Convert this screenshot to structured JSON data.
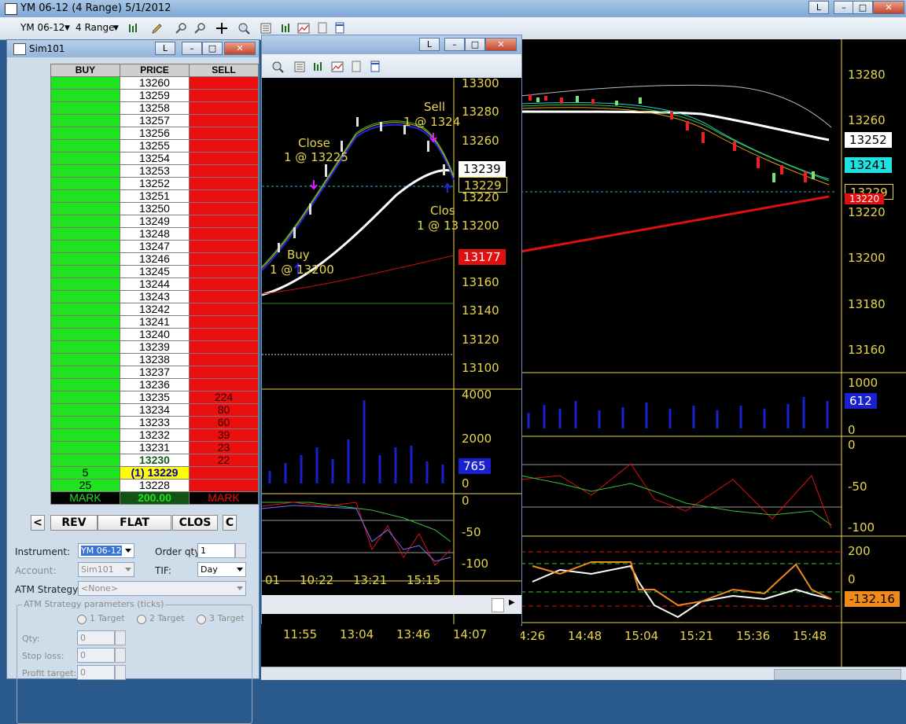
{
  "window": {
    "title": "YM 06-12 (4 Range)  5/1/2012",
    "link_btn": "L",
    "min_btn": "–",
    "max_btn": "□",
    "close_btn": "✕"
  },
  "toolbar": {
    "instrument": "YM 06-12",
    "period": "4 Range"
  },
  "main_chart": {
    "price_axis": [
      "13280",
      "13260",
      "13240",
      "13220",
      "13200",
      "13180",
      "13160"
    ],
    "tags": {
      "white": "13252",
      "cyan": "13241",
      "last": "13229",
      "red": "13220"
    },
    "volume_axis": [
      "1000",
      "500",
      "0"
    ],
    "volume_tag": "612",
    "osc_axis": [
      "0",
      "-50",
      "-100"
    ],
    "cci_axis": [
      "200",
      "0",
      "-200"
    ],
    "cci_tag": "-132.16",
    "time_axis": [
      "14:26",
      "14:48",
      "15:04",
      "15:21",
      "15:36",
      "15:48"
    ],
    "colors": {
      "axis_text": "#e8d54a",
      "ema_red": "#e01010",
      "band_white": "#ffffff",
      "last_line": "#22b8d6"
    }
  },
  "inner_chart": {
    "link_btn": "L",
    "price_axis": [
      "13300",
      "13280",
      "13260",
      "13240",
      "13220",
      "13200",
      "13180",
      "13160",
      "13140",
      "13120",
      "13100"
    ],
    "tags": {
      "white": "13239",
      "last": "13229",
      "red": "13177"
    },
    "volume_axis": [
      "4000",
      "2000",
      "0"
    ],
    "volume_tag": "765",
    "osc_axis": [
      "0",
      "-50",
      "-100"
    ],
    "time_axis": [
      "10:22",
      "13:21",
      "15:15"
    ],
    "time_partial": "01",
    "bottom_time_axis": [
      "11:55",
      "13:04",
      "13:46",
      "14:07"
    ],
    "annotations": {
      "close1_line1": "Close",
      "close1_line2": "1 @ 13225",
      "buy_line1": "Buy",
      "buy_line2": "1 @ 13200",
      "sell_line1": "Sell",
      "sell_line2": "1 @ 1324",
      "close2_line1": "Clos",
      "close2_line2": "1 @ 13"
    }
  },
  "dom": {
    "title": "Sim101",
    "link_btn": "L",
    "headers": {
      "buy": "BUY",
      "price": "PRICE",
      "sell": "SELL"
    },
    "rows": [
      {
        "buy": "",
        "price": "13260",
        "sell": ""
      },
      {
        "buy": "",
        "price": "13259",
        "sell": ""
      },
      {
        "buy": "",
        "price": "13258",
        "sell": ""
      },
      {
        "buy": "",
        "price": "13257",
        "sell": ""
      },
      {
        "buy": "",
        "price": "13256",
        "sell": ""
      },
      {
        "buy": "",
        "price": "13255",
        "sell": ""
      },
      {
        "buy": "",
        "price": "13254",
        "sell": ""
      },
      {
        "buy": "",
        "price": "13253",
        "sell": ""
      },
      {
        "buy": "",
        "price": "13252",
        "sell": ""
      },
      {
        "buy": "",
        "price": "13251",
        "sell": ""
      },
      {
        "buy": "",
        "price": "13250",
        "sell": ""
      },
      {
        "buy": "",
        "price": "13249",
        "sell": ""
      },
      {
        "buy": "",
        "price": "13248",
        "sell": ""
      },
      {
        "buy": "",
        "price": "13247",
        "sell": ""
      },
      {
        "buy": "",
        "price": "13246",
        "sell": ""
      },
      {
        "buy": "",
        "price": "13245",
        "sell": ""
      },
      {
        "buy": "",
        "price": "13244",
        "sell": ""
      },
      {
        "buy": "",
        "price": "13243",
        "sell": ""
      },
      {
        "buy": "",
        "price": "13242",
        "sell": ""
      },
      {
        "buy": "",
        "price": "13241",
        "sell": ""
      },
      {
        "buy": "",
        "price": "13240",
        "sell": ""
      },
      {
        "buy": "",
        "price": "13239",
        "sell": ""
      },
      {
        "buy": "",
        "price": "13238",
        "sell": ""
      },
      {
        "buy": "",
        "price": "13237",
        "sell": ""
      },
      {
        "buy": "",
        "price": "13236",
        "sell": ""
      },
      {
        "buy": "",
        "price": "13235",
        "sell": "224"
      },
      {
        "buy": "",
        "price": "13234",
        "sell": "80"
      },
      {
        "buy": "",
        "price": "13233",
        "sell": "60"
      },
      {
        "buy": "",
        "price": "13232",
        "sell": "39"
      },
      {
        "buy": "",
        "price": "13231",
        "sell": "23"
      },
      {
        "buy": "",
        "price": "13230",
        "sell": "22",
        "bid": true
      },
      {
        "buy": "5",
        "price": "(1) 13229",
        "sell": "",
        "last": true
      },
      {
        "buy": "25",
        "price": "13228",
        "sell": ""
      }
    ],
    "mark": {
      "buy": "MARK",
      "price": "200.00",
      "sell": "MARK"
    },
    "buttons": {
      "left": "<",
      "rev": "REV",
      "flat": "FLAT",
      "close": "CLOS",
      "right": "C"
    },
    "form": {
      "instrument_label": "Instrument:",
      "instrument_value": "YM 06-12",
      "order_qty_label": "Order qty:",
      "order_qty_value": "1",
      "account_label": "Account:",
      "account_value": "Sim101",
      "tif_label": "TIF:",
      "tif_value": "Day",
      "atm_label": "ATM Strategy:",
      "atm_value": "<None>",
      "params_legend": "ATM Strategy parameters (ticks)",
      "target1": "1 Target",
      "target2": "2 Target",
      "target3": "3 Target",
      "qty_label": "Qty:",
      "qty_value": "0",
      "stop_label": "Stop loss:",
      "stop_value": "0",
      "profit_label": "Profit target:",
      "profit_value": "0"
    }
  }
}
